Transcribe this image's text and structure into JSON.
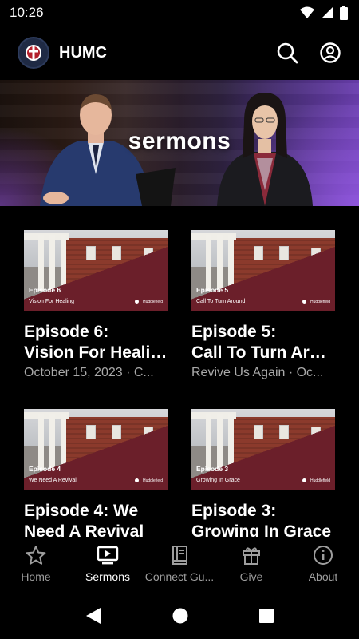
{
  "status_bar": {
    "time": "10:26"
  },
  "app_bar": {
    "title": "HUMC"
  },
  "hero": {
    "title": "sermons"
  },
  "episodes": [
    {
      "thumb_episode": "Episode 6",
      "thumb_subtitle": "Vision For Healing",
      "title_line1": "Episode 6:",
      "title_line2": "Vision For Healing",
      "meta": "October 15, 2023 · C..."
    },
    {
      "thumb_episode": "Episode 5",
      "thumb_subtitle": "Call To Turn Around",
      "title_line1": "Episode 5:",
      "title_line2": "Call To Turn Around",
      "meta": "Revive Us Again · Oc..."
    },
    {
      "thumb_episode": "Episode 4",
      "thumb_subtitle": "We Need A Revival",
      "title_line1": "Episode 4: We",
      "title_line2": "Need A Revival",
      "meta": ""
    },
    {
      "thumb_episode": "Episode 3",
      "thumb_subtitle": "Growing In Grace",
      "title_line1": "Episode 3:",
      "title_line2": "Growing In Grace",
      "meta": ""
    }
  ],
  "thumb_brand": "Huddlefield",
  "bottom_nav": [
    {
      "label": "Home",
      "icon": "star-icon"
    },
    {
      "label": "Sermons",
      "icon": "tv-icon",
      "active": true
    },
    {
      "label": "Connect Gu...",
      "icon": "book-icon"
    },
    {
      "label": "Give",
      "icon": "gift-icon"
    },
    {
      "label": "About",
      "icon": "info-icon"
    }
  ],
  "colors": {
    "background": "#000000",
    "accent_band": "#6b1f2a",
    "muted_text": "#a9a9a9"
  }
}
